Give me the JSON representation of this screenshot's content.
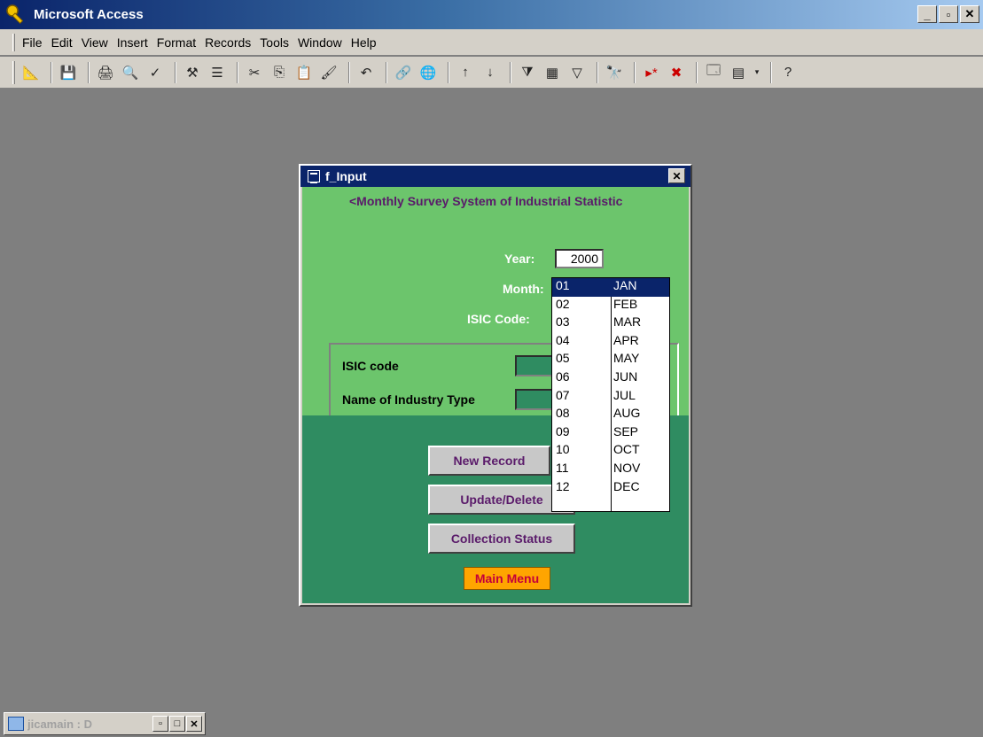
{
  "app": {
    "title": "Microsoft Access",
    "icon": "key-icon",
    "window_buttons": [
      "_",
      "▫",
      "×"
    ]
  },
  "menu": {
    "items": [
      "File",
      "Edit",
      "View",
      "Insert",
      "Format",
      "Records",
      "Tools",
      "Window",
      "Help"
    ]
  },
  "toolbar": {
    "icons": [
      "design-view-icon",
      "save-icon",
      "print-icon",
      "print-preview-icon",
      "spelling-icon",
      "format-painter-icon",
      "office-links-icon",
      "cut-icon",
      "copy-icon",
      "paste-icon",
      "undo-icon",
      "insert-hyperlink-icon",
      "web-icon",
      "sort-ascending-icon",
      "sort-descending-icon",
      "filter-by-selection-icon",
      "filter-by-form-icon",
      "apply-filter-icon",
      "find-icon",
      "new-record-icon",
      "delete-record-icon",
      "database-window-icon",
      "new-object-icon",
      "help-icon"
    ]
  },
  "form": {
    "title": "f_Input",
    "heading": "<Monthly Survey System of Industrial Statistic",
    "year_label": "Year:",
    "year_value": "2000",
    "month_label": "Month:",
    "month_value": "01",
    "isic_label": "ISIC Code:",
    "frame": {
      "isic_code_label": "ISIC code",
      "industry_type_label": "Name of Industry Type"
    },
    "buttons": {
      "new_record": "New Record",
      "update_delete": "Update/Delete",
      "collection_status": "Collection Status",
      "main_menu": "Main Menu"
    }
  },
  "month_dropdown": {
    "selected_index": 0,
    "options": [
      {
        "num": "01",
        "abbr": "JAN"
      },
      {
        "num": "02",
        "abbr": "FEB"
      },
      {
        "num": "03",
        "abbr": "MAR"
      },
      {
        "num": "04",
        "abbr": "APR"
      },
      {
        "num": "05",
        "abbr": "MAY"
      },
      {
        "num": "06",
        "abbr": "JUN"
      },
      {
        "num": "07",
        "abbr": "JUL"
      },
      {
        "num": "08",
        "abbr": "AUG"
      },
      {
        "num": "09",
        "abbr": "SEP"
      },
      {
        "num": "10",
        "abbr": "OCT"
      },
      {
        "num": "11",
        "abbr": "NOV"
      },
      {
        "num": "12",
        "abbr": "DEC"
      }
    ]
  },
  "minimized_window": {
    "title": "jicamain : D"
  }
}
